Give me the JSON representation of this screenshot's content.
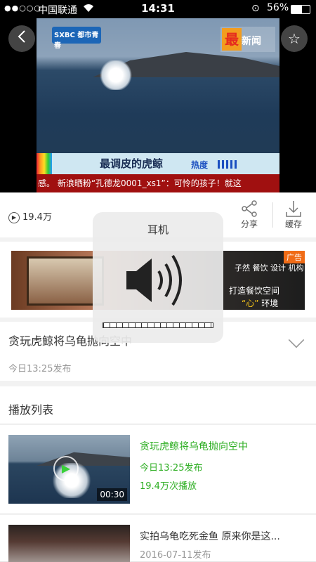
{
  "status_bar": {
    "signal": "●●○○○",
    "carrier": "中国联通",
    "time": "14:31",
    "battery_pct": "56%",
    "battery_level": 0.56
  },
  "video": {
    "channel_logo": "SXBC 都市青春",
    "news_logo": "新闻",
    "news_logo_mark": "最",
    "banner_title": "最调皮的虎鲸",
    "banner_hot": "热度",
    "ticker": "感。 新浪晒粉“孔德龙0001_xs1”：可怜的孩子！就这"
  },
  "stats": {
    "views": "19.4万",
    "share_label": "分享",
    "cache_label": "缓存"
  },
  "ad": {
    "tag": "广告",
    "brand": "子然 餐饮 设计 机构",
    "slogan_line1": "打造餐饮空间",
    "slogan_line2_quote": "“心”",
    "slogan_line2_rest": "环境"
  },
  "video_info": {
    "title": "贪玩虎鲸将乌龟抛向空中",
    "date": "今日13:25发布"
  },
  "volume_hud": {
    "label": "耳机",
    "level": 0
  },
  "playlist": {
    "header": "播放列表",
    "items": [
      {
        "title": "贪玩虎鲸将乌龟抛向空中",
        "date": "今日13:25发布",
        "plays": "19.4万次播放",
        "duration": "00:30",
        "active": true
      },
      {
        "title": "实拍乌龟吃死金鱼 原来你是这...",
        "date": "2016-07-11发布",
        "active": false
      }
    ]
  }
}
